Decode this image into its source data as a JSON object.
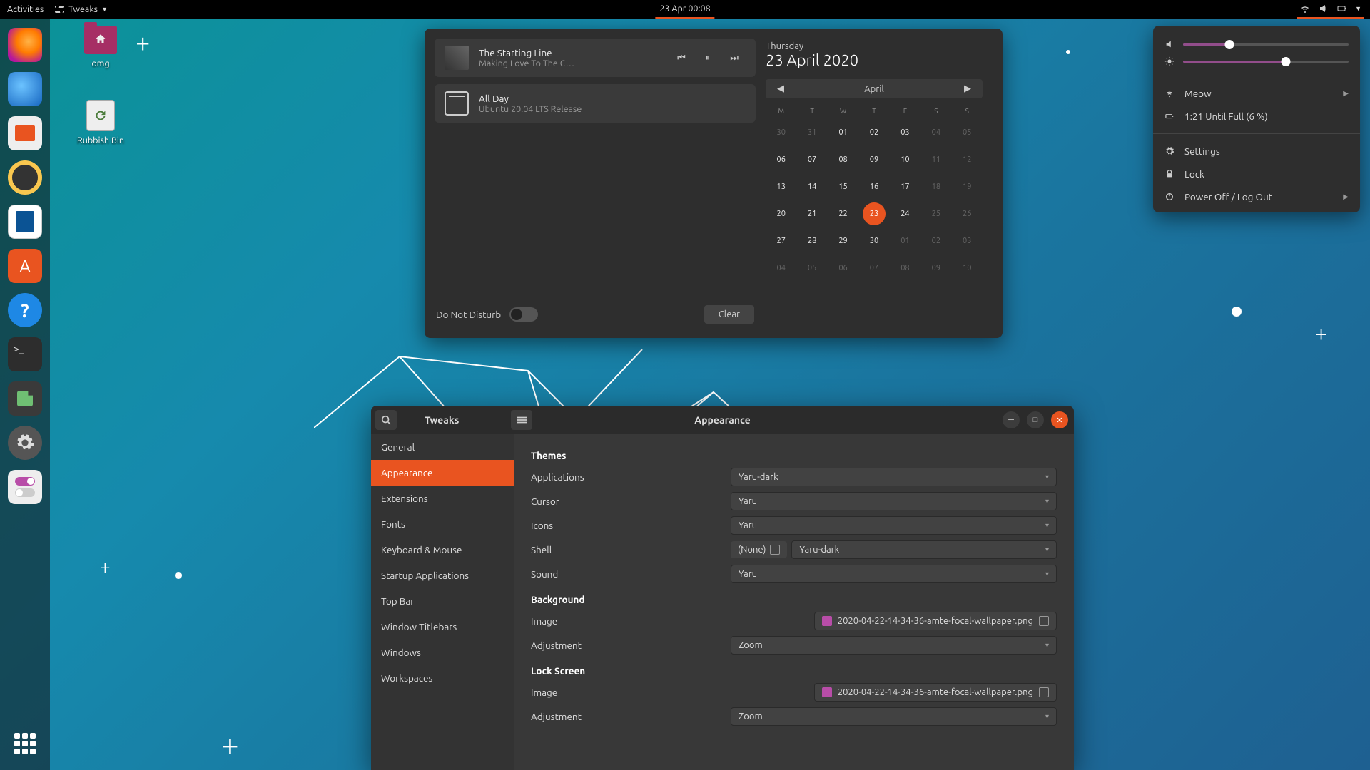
{
  "topbar": {
    "activities": "Activities",
    "app_label": "Tweaks",
    "clock": "23 Apr  00:08"
  },
  "desktop": {
    "folder_label": "omg",
    "trash_label": "Rubbish Bin"
  },
  "dock": {
    "apps": [
      "firefox",
      "thunderbird",
      "files",
      "rhythmbox",
      "libreoffice-writer",
      "software",
      "help",
      "terminal",
      "extensions",
      "settings",
      "tweaks"
    ]
  },
  "calendar_pop": {
    "media": {
      "title": "The Starting Line",
      "subtitle": "Making Love To The C…"
    },
    "event": {
      "title": "All Day",
      "subtitle": "Ubuntu 20.04 LTS Release"
    },
    "dnd_label": "Do Not Disturb",
    "clear_label": "Clear",
    "dow": "Thursday",
    "date_long": "23 April 2020",
    "month": "April",
    "weekdays": [
      "M",
      "T",
      "W",
      "T",
      "F",
      "S",
      "S"
    ],
    "days": [
      {
        "n": "30",
        "m": true
      },
      {
        "n": "31",
        "m": true
      },
      {
        "n": "01"
      },
      {
        "n": "02"
      },
      {
        "n": "03"
      },
      {
        "n": "04",
        "m": true
      },
      {
        "n": "05",
        "m": true
      },
      {
        "n": "06"
      },
      {
        "n": "07"
      },
      {
        "n": "08"
      },
      {
        "n": "09"
      },
      {
        "n": "10"
      },
      {
        "n": "11",
        "m": true
      },
      {
        "n": "12",
        "m": true
      },
      {
        "n": "13"
      },
      {
        "n": "14"
      },
      {
        "n": "15"
      },
      {
        "n": "16"
      },
      {
        "n": "17"
      },
      {
        "n": "18",
        "m": true
      },
      {
        "n": "19",
        "m": true
      },
      {
        "n": "20"
      },
      {
        "n": "21"
      },
      {
        "n": "22"
      },
      {
        "n": "23",
        "today": true
      },
      {
        "n": "24"
      },
      {
        "n": "25",
        "m": true
      },
      {
        "n": "26",
        "m": true
      },
      {
        "n": "27"
      },
      {
        "n": "28"
      },
      {
        "n": "29"
      },
      {
        "n": "30"
      },
      {
        "n": "01",
        "m": true
      },
      {
        "n": "02",
        "m": true
      },
      {
        "n": "03",
        "m": true
      },
      {
        "n": "04",
        "m": true
      },
      {
        "n": "05",
        "m": true
      },
      {
        "n": "06",
        "m": true
      },
      {
        "n": "07",
        "m": true
      },
      {
        "n": "08",
        "m": true
      },
      {
        "n": "09",
        "m": true
      },
      {
        "n": "10",
        "m": true
      }
    ]
  },
  "status_pop": {
    "volume_pct": 28,
    "brightness_pct": 62,
    "items": [
      {
        "icon": "wifi",
        "label": "Meow",
        "chev": true
      },
      {
        "icon": "battery",
        "label": "1:21 Until Full (6 %)"
      },
      {
        "icon": "settings",
        "label": "Settings"
      },
      {
        "icon": "lock",
        "label": "Lock"
      },
      {
        "icon": "power",
        "label": "Power Off / Log Out",
        "chev": true
      }
    ]
  },
  "tweaks": {
    "title": "Tweaks",
    "panel_title": "Appearance",
    "sidebar": [
      "General",
      "Appearance",
      "Extensions",
      "Fonts",
      "Keyboard & Mouse",
      "Startup Applications",
      "Top Bar",
      "Window Titlebars",
      "Windows",
      "Workspaces"
    ],
    "sections": {
      "themes": {
        "header": "Themes",
        "rows": [
          {
            "label": "Applications",
            "value": "Yaru-dark"
          },
          {
            "label": "Cursor",
            "value": "Yaru"
          },
          {
            "label": "Icons",
            "value": "Yaru"
          },
          {
            "label": "Shell",
            "value": "Yaru-dark",
            "shell_none": "(None)"
          },
          {
            "label": "Sound",
            "value": "Yaru"
          }
        ]
      },
      "background": {
        "header": "Background",
        "image_label": "Image",
        "image_value": "2020-04-22-14-34-36-amte-focal-wallpaper.png",
        "adjust_label": "Adjustment",
        "adjust_value": "Zoom"
      },
      "lockscreen": {
        "header": "Lock Screen",
        "image_label": "Image",
        "image_value": "2020-04-22-14-34-36-amte-focal-wallpaper.png",
        "adjust_label": "Adjustment",
        "adjust_value": "Zoom"
      }
    }
  }
}
